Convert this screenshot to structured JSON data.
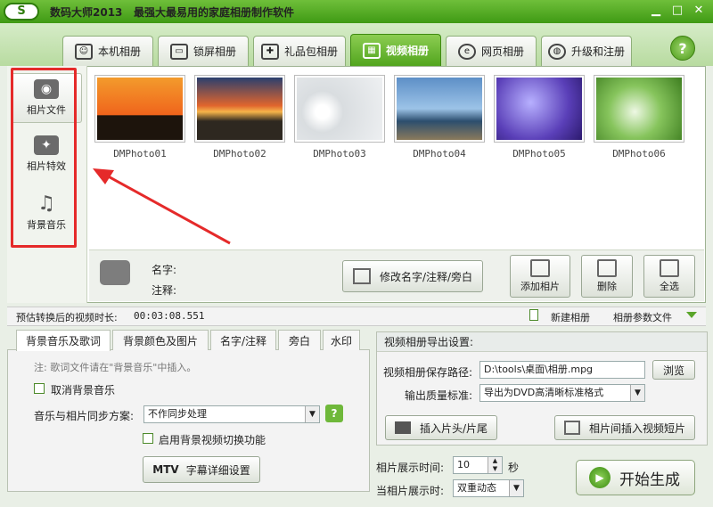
{
  "window": {
    "logo": "S",
    "title": "数码大师2013",
    "slogan": "最强大最易用的家庭相册制作软件",
    "min": "▁",
    "max": "□",
    "close": "✕"
  },
  "tabs": [
    {
      "label": "本机相册",
      "icon": "computer-user-icon"
    },
    {
      "label": "锁屏相册",
      "icon": "monitor-icon"
    },
    {
      "label": "礼品包相册",
      "icon": "gift-icon"
    },
    {
      "label": "视频相册",
      "icon": "film-icon",
      "active": true
    },
    {
      "label": "网页相册",
      "icon": "ie-icon"
    },
    {
      "label": "升级和注册",
      "icon": "globe-icon"
    }
  ],
  "help": "?",
  "nav": [
    {
      "label": "相片文件",
      "icon": "camera-icon",
      "active": true
    },
    {
      "label": "相片特效",
      "icon": "effects-icon"
    },
    {
      "label": "背景音乐",
      "icon": "music-note-icon"
    }
  ],
  "photos": [
    "DMPhoto01",
    "DMPhoto02",
    "DMPhoto03",
    "DMPhoto04",
    "DMPhoto05",
    "DMPhoto06"
  ],
  "info": {
    "name_label": "名字:",
    "note_label": "注释:",
    "edit_button": "修改名字/注释/旁白"
  },
  "actions": {
    "add": "添加相片",
    "delete": "删除",
    "select_all": "全选"
  },
  "status": {
    "duration_label": "预估转换后的视频时长:",
    "duration_value": "00:03:08.551",
    "new_album": "新建相册",
    "album_params": "相册参数文件"
  },
  "lower_tabs": [
    "背景音乐及歌词",
    "背景颜色及图片",
    "名字/注释",
    "旁白",
    "水印"
  ],
  "music": {
    "note": "注: 歌词文件请在\"背景音乐\"中插入。",
    "cancel_bg_music": "取消背景音乐",
    "sync_label": "音乐与相片同步方案:",
    "sync_value": "不作同步处理",
    "sync_help": "?",
    "enable_bg_video": "启用背景视频切换功能",
    "mtv_button_prefix": "MTV",
    "mtv_button": "字幕详细设置"
  },
  "export": {
    "header": "视频相册导出设置:",
    "path_label": "视频相册保存路径:",
    "path_value": "D:\\tools\\桌面\\相册.mpg",
    "browse": "浏览",
    "quality_label": "输出质量标准:",
    "quality_value": "导出为DVD高清晰标准格式",
    "insert_head_tail": "插入片头/片尾",
    "insert_clip": "相片间插入视频短片"
  },
  "timing": {
    "show_time_label": "相片展示时间:",
    "show_time_value": "10",
    "unit": "秒",
    "when_show_label": "当相片展示时:",
    "when_show_value": "双重动态"
  },
  "start": "开始生成",
  "colors": {
    "accent": "#52a51e",
    "highlight": "#e52a2a"
  }
}
